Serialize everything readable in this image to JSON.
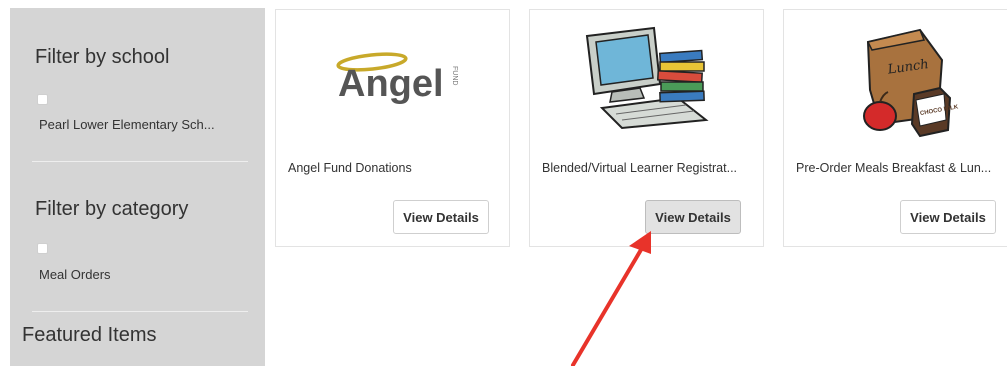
{
  "sidebar": {
    "school_filter": {
      "title": "Filter by school",
      "option": "Pearl Lower Elementary Sch..."
    },
    "category_filter": {
      "title": "Filter by category",
      "option": "Meal Orders"
    },
    "featured_title": "Featured Items"
  },
  "cards": [
    {
      "title": "Angel Fund Donations",
      "button": "View Details",
      "logo_text": "Angel",
      "logo_small": "FUND",
      "image": "angel-fund-logo"
    },
    {
      "title": "Blended/Virtual Learner Registrat...",
      "button": "View Details",
      "image": "computer-books-illustration"
    },
    {
      "title": "Pre-Order Meals Breakfast & Lun...",
      "button": "View Details",
      "bag_text": "Lunch",
      "milk_text": "CHOCO MILK",
      "image": "lunch-bag-illustration"
    }
  ],
  "colors": {
    "sidebar_bg": "#d5d5d5",
    "angel_gold": "#c8a92a",
    "arrow_red": "#e8332a"
  }
}
